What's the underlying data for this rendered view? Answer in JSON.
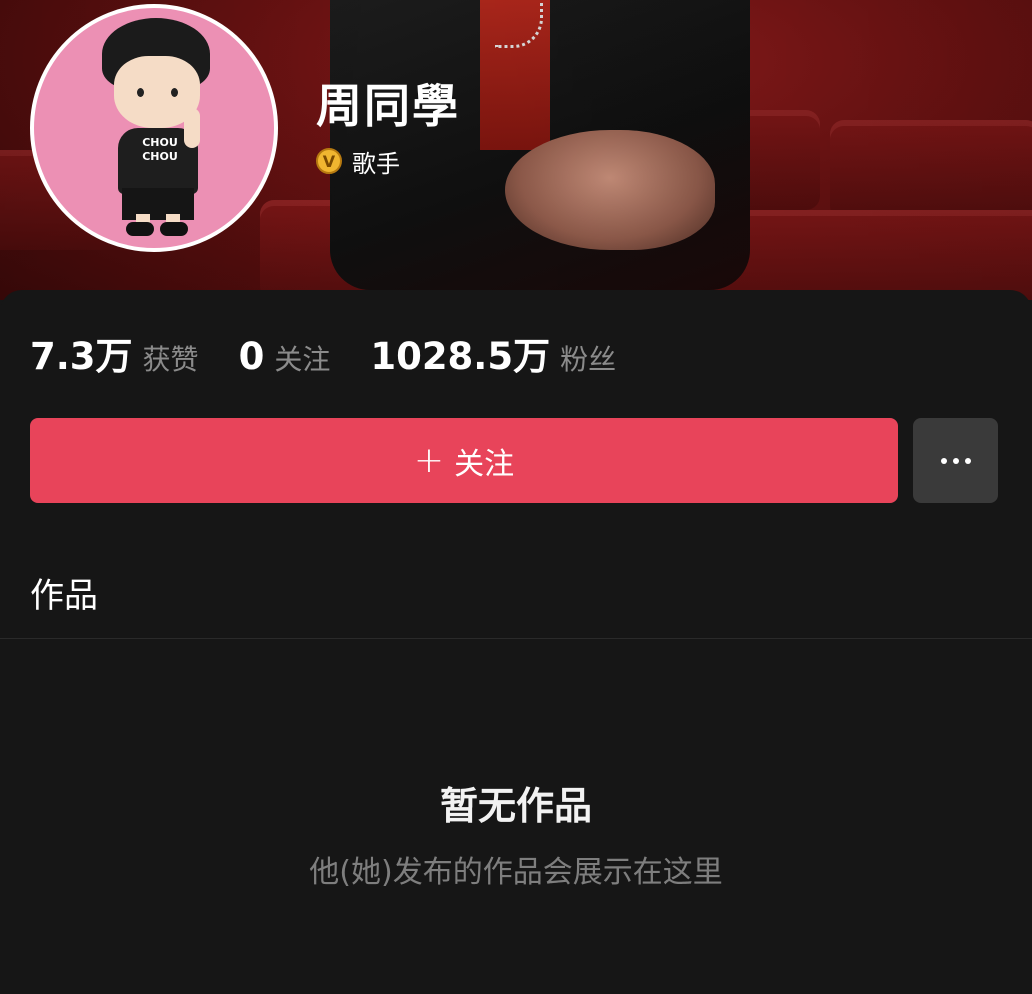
{
  "header": {
    "name": "周同學",
    "badge_letter": "V",
    "role": "歌手",
    "avatar_shirt_text": "CHOU CHOU"
  },
  "stats": [
    {
      "value": "7.3万",
      "label": "获赞"
    },
    {
      "value": "0",
      "label": "关注"
    },
    {
      "value": "1028.5万",
      "label": "粉丝"
    }
  ],
  "actions": {
    "follow_icon": "+",
    "follow_label": "关注",
    "more_icon": "more-icon"
  },
  "tabs": {
    "works": "作品"
  },
  "empty_state": {
    "title": "暂无作品",
    "subtitle": "他(她)发布的作品会展示在这里"
  },
  "colors": {
    "follow_button": "#e8445a",
    "badge": "#f0b630",
    "background": "#161616"
  }
}
